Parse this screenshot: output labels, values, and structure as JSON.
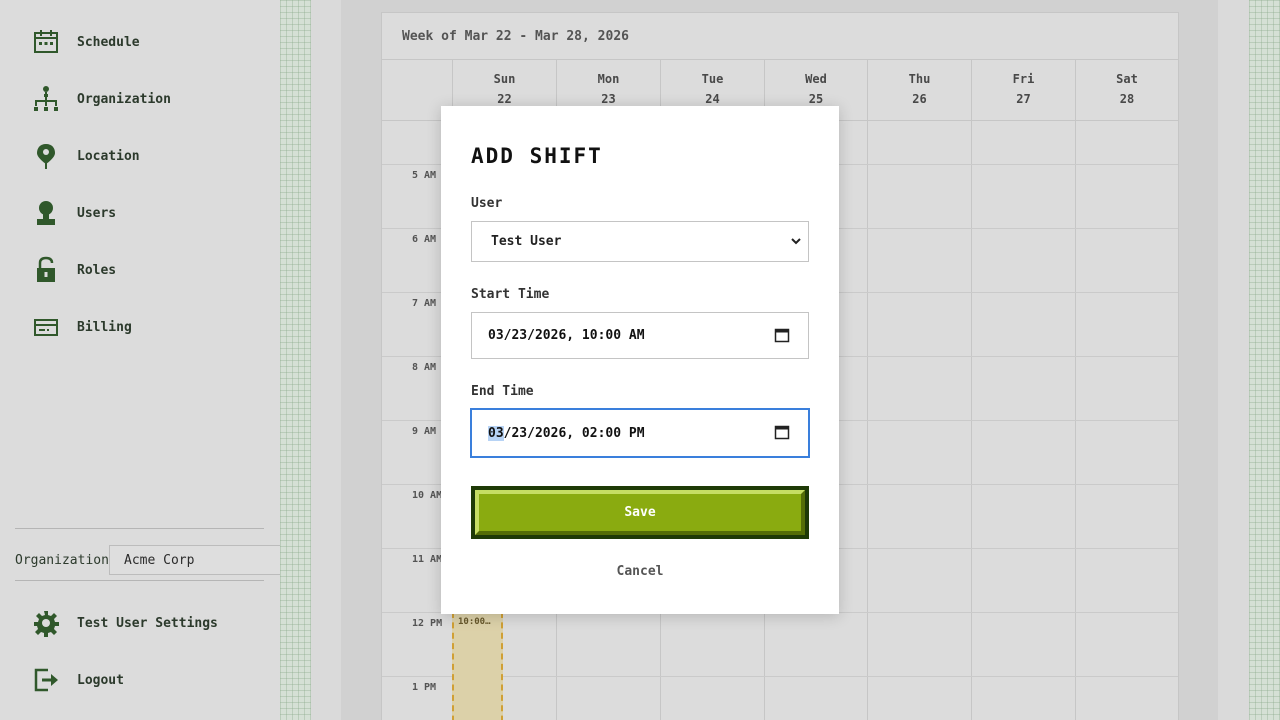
{
  "sidebar": {
    "nav": [
      {
        "label": "Schedule",
        "icon": "calendar-icon"
      },
      {
        "label": "Organization",
        "icon": "org-chart-icon"
      },
      {
        "label": "Location",
        "icon": "map-pin-icon"
      },
      {
        "label": "Users",
        "icon": "user-icon"
      },
      {
        "label": "Roles",
        "icon": "lock-icon"
      },
      {
        "label": "Billing",
        "icon": "credit-card-icon"
      }
    ],
    "organization_label": "Organization",
    "organization_value": "Acme Corp",
    "settings_label": "Test User Settings",
    "logout_label": "Logout"
  },
  "calendar": {
    "week_title": "Week of Mar 22 - Mar 28, 2026",
    "days": [
      {
        "name": "Sun",
        "num": "22"
      },
      {
        "name": "Mon",
        "num": "23"
      },
      {
        "name": "Tue",
        "num": "24"
      },
      {
        "name": "Wed",
        "num": "25"
      },
      {
        "name": "Thu",
        "num": "26"
      },
      {
        "name": "Fri",
        "num": "27"
      },
      {
        "name": "Sat",
        "num": "28"
      }
    ],
    "hours": [
      "5 AM",
      "6 AM",
      "7 AM",
      "8 AM",
      "9 AM",
      "10 AM",
      "11 AM",
      "12 PM",
      "1 PM"
    ],
    "shift_label": "10:00…"
  },
  "modal": {
    "title": "Add Shift",
    "user_label": "User",
    "user_value": "Test User",
    "start_label": "Start Time",
    "start_value": "03/23/2026, 10:00 AM",
    "end_label": "End Time",
    "end_value_month": "03",
    "end_value_rest": "/23/2026, 02:00 PM",
    "save_label": "Save",
    "cancel_label": "Cancel"
  },
  "colors": {
    "accent_green": "#8aab10",
    "dark_green": "#1e3a06",
    "focus_blue": "#3a7fdc",
    "shift_border": "#d9a635"
  }
}
